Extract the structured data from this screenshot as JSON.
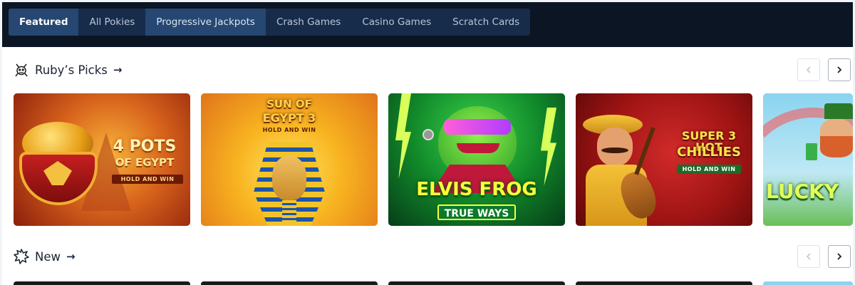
{
  "nav": {
    "tabs": [
      {
        "label": "Featured"
      },
      {
        "label": "All Pokies"
      },
      {
        "label": "Progressive Jackpots"
      },
      {
        "label": "Crash Games"
      },
      {
        "label": "Casino Games"
      },
      {
        "label": "Scratch Cards"
      }
    ]
  },
  "sections": [
    {
      "title": "Ruby’s Picks",
      "icon": "mascot-icon"
    },
    {
      "title": "New",
      "icon": "burst-star-icon"
    }
  ],
  "games": [
    {
      "name": "4 Pots of Egypt",
      "title_line1": "4 POTS",
      "title_line2": "OF EGYPT",
      "subtitle": "HOLD AND WIN"
    },
    {
      "name": "Sun of Egypt 3",
      "title_line1": "SUN OF",
      "title_line2": "EGYPT 3",
      "subtitle": "HOLD AND WIN"
    },
    {
      "name": "Elvis Frog Trueways",
      "title_line1": "ELVIS FROG",
      "title_line2": "TRUE WAYS",
      "subtitle": ""
    },
    {
      "name": "3 Hot Chillies",
      "title_line1": "SUPER 3 HOT",
      "title_line2": "CHILLIES",
      "subtitle": "HOLD AND WIN"
    },
    {
      "name": "Lucky",
      "title_line1": "LUCKY",
      "title_line2": "",
      "subtitle": ""
    }
  ],
  "colors": {
    "topbar": "#0b1523",
    "tab_bg": "#172c4a",
    "tab_active": "#254772"
  }
}
